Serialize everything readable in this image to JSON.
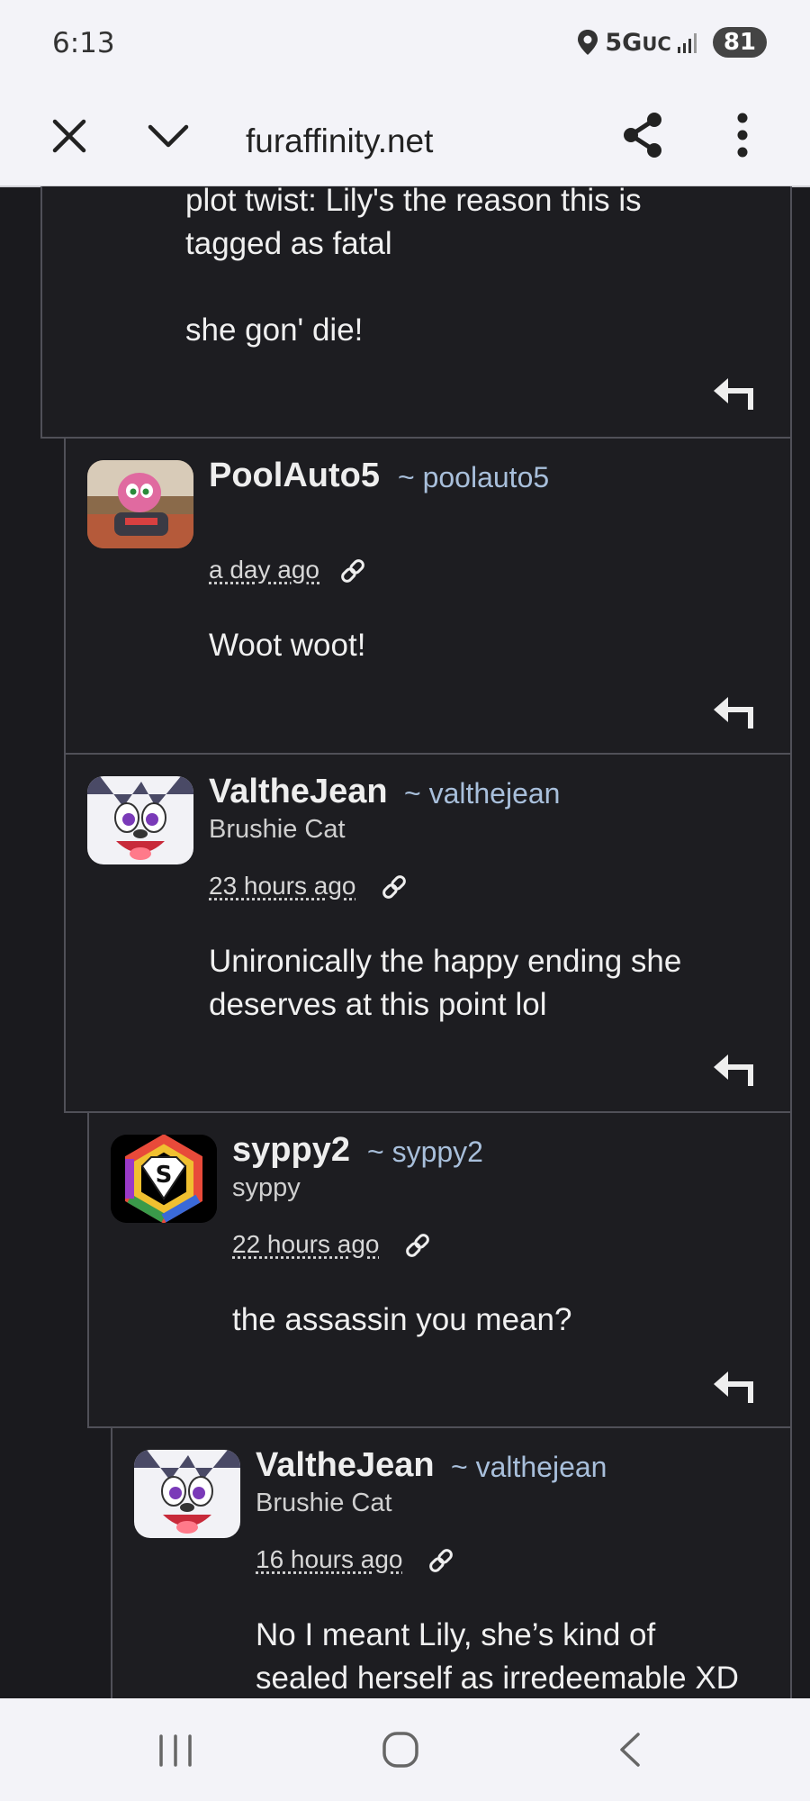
{
  "status_bar": {
    "time": "6:13",
    "network": "5G",
    "network_suffix": "UC",
    "battery": "81"
  },
  "toolbar": {
    "url": "furaffinity.net"
  },
  "comments": [
    {
      "text": "plot twist: Lily's the reason this is\ntagged as fatal\n\nshe gon' die!"
    },
    {
      "name": "PoolAuto5",
      "handle": "~ poolauto5",
      "time": "a day ago",
      "text": "Woot woot!"
    },
    {
      "name": "ValtheJean",
      "handle": "~ valthejean",
      "title": "Brushie Cat",
      "time": "23 hours ago",
      "text": "Unironically the happy ending she\ndeserves at this point lol"
    },
    {
      "name": "syppy2",
      "handle": "~ syppy2",
      "title": "syppy",
      "time": "22 hours ago",
      "text": "the assassin you mean?"
    },
    {
      "name": "ValtheJean",
      "handle": "~ valthejean",
      "title": "Brushie Cat",
      "time": "16 hours ago",
      "text": "No I meant Lily, she’s kind of\nsealed herself as irredeemable XD"
    }
  ]
}
